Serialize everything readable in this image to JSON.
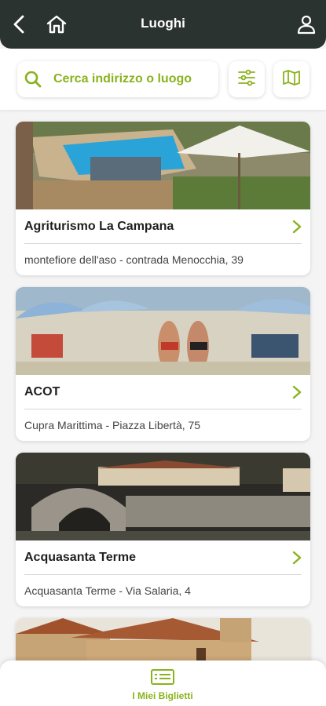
{
  "header": {
    "title": "Luoghi",
    "back_icon": "back-arrow-icon",
    "home_icon": "home-icon",
    "user_icon": "user-icon"
  },
  "search": {
    "placeholder": "Cerca indirizzo o luogo",
    "search_icon": "search-icon",
    "filters_icon": "sliders-icon",
    "map_icon": "map-icon"
  },
  "places": [
    {
      "name": "Agriturismo La Campana",
      "address": "montefiore dell'aso - contrada Menocchia, 39",
      "photo": "pool-with-umbrella"
    },
    {
      "name": "ACOT",
      "address": "Cupra Marittima - Piazza Libertà, 75",
      "photo": "beach-with-umbrellas"
    },
    {
      "name": "Acquasanta Terme",
      "address": "Acquasanta Terme - Via Salaria, 4",
      "photo": "stone-bridge-village"
    },
    {
      "name": "",
      "address": "",
      "photo": "brick-buildings"
    }
  ],
  "bottom_nav": {
    "tab_label": "I Miei Biglietti",
    "tab_icon": "ticket-icon"
  },
  "colors": {
    "accent": "#8ab21e",
    "header_bg": "#2b3331",
    "page_bg": "#f4f4f4"
  }
}
